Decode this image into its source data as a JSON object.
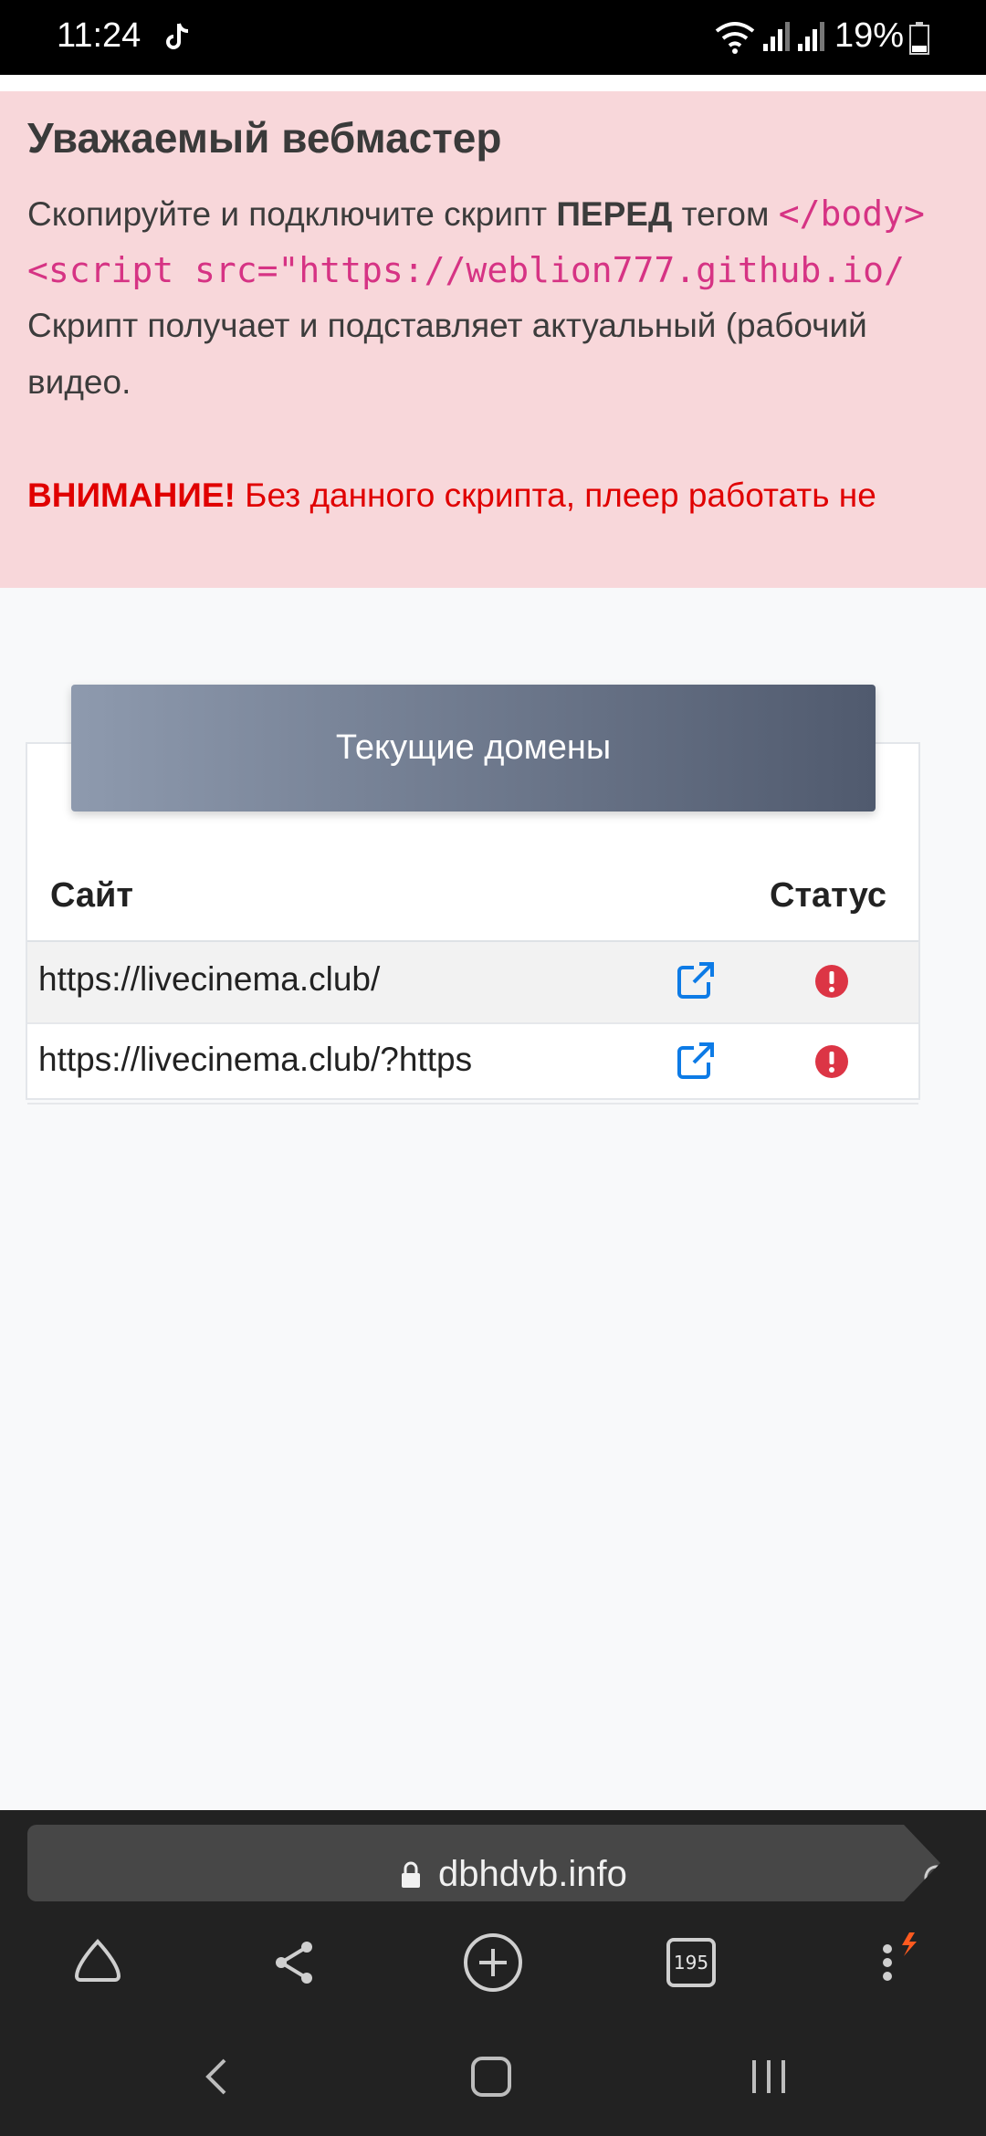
{
  "status_bar": {
    "time": "11:24",
    "battery": "19%"
  },
  "alert": {
    "heading": "Уважаемый вебмастер",
    "line1_start": "Скопируйте и подключите скрипт ",
    "line1_bold": "ПЕРЕД",
    "line1_mid": " тегом ",
    "line1_code": "</body>",
    "line2_code": "<script src=\"https://weblion777.github.io/",
    "line3": "Скрипт получает и подставляет актуальный (рабочий",
    "line4": "видео.",
    "warn_bold": "ВНИМАНИЕ!",
    "warn_text": " Без данного скрипта, плеер работать не"
  },
  "domains": {
    "title": "Текущие домены",
    "col_site": "Сайт",
    "col_status": "Статус",
    "rows": [
      {
        "url": "https://livecinema.club/"
      },
      {
        "url": "https://livecinema.club/?https"
      }
    ]
  },
  "browser": {
    "domain": "dbhdvb.info",
    "tabs_count": "195"
  },
  "colors": {
    "error": "#dc3545",
    "link": "#0d7be6",
    "alert_bg": "#f8d7da",
    "code": "#d63384"
  }
}
